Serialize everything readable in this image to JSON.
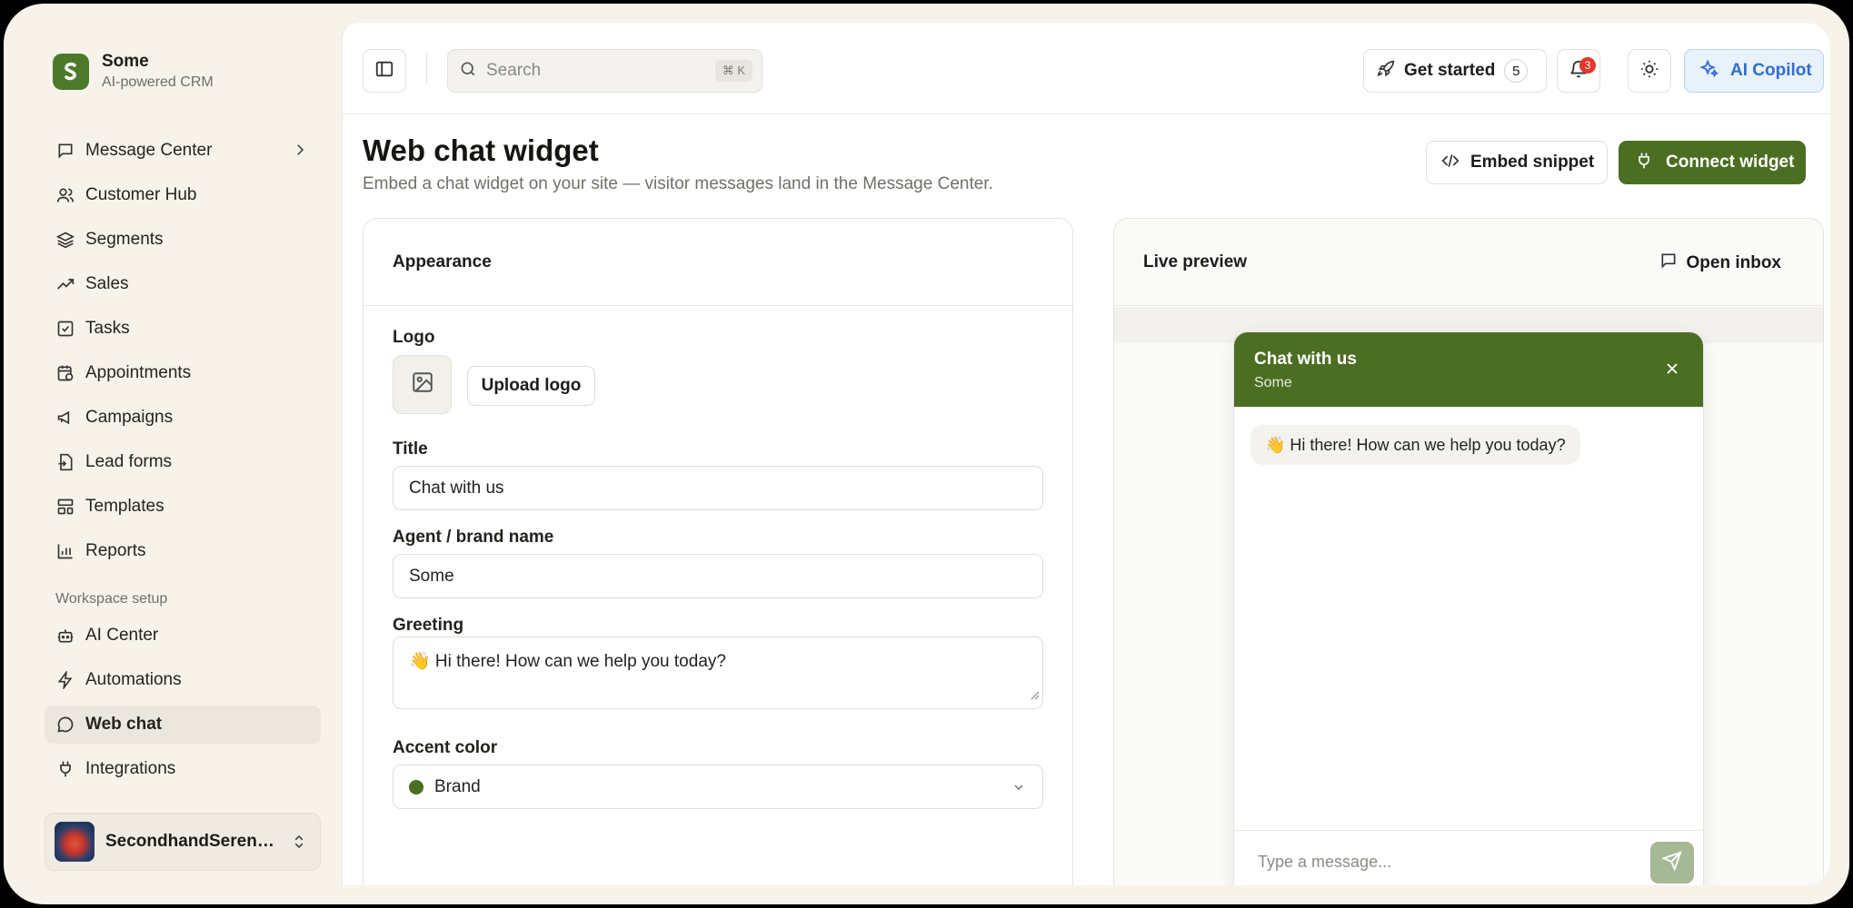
{
  "brand": {
    "name": "Some",
    "tagline": "AI-powered CRM"
  },
  "nav": {
    "items": [
      {
        "label": "Message Center"
      },
      {
        "label": "Customer Hub"
      },
      {
        "label": "Segments"
      },
      {
        "label": "Sales"
      },
      {
        "label": "Tasks"
      },
      {
        "label": "Appointments"
      },
      {
        "label": "Campaigns"
      },
      {
        "label": "Lead forms"
      },
      {
        "label": "Templates"
      },
      {
        "label": "Reports"
      }
    ],
    "section_label": "Workspace setup",
    "setup_items": [
      {
        "label": "AI Center"
      },
      {
        "label": "Automations"
      },
      {
        "label": "Web chat"
      },
      {
        "label": "Integrations"
      }
    ]
  },
  "account": {
    "name": "SecondhandSerenade"
  },
  "topbar": {
    "search_placeholder": "Search",
    "search_shortcut": "⌘ K",
    "get_started_label": "Get started",
    "get_started_count": "5",
    "notifications_count": "3",
    "ai_copilot_label": "AI Copilot"
  },
  "page": {
    "title": "Web chat widget",
    "subtitle": "Embed a chat widget on your site — visitor messages land in the Message Center.",
    "embed_label": "Embed snippet",
    "connect_label": "Connect widget"
  },
  "appearance": {
    "header": "Appearance",
    "logo_label": "Logo",
    "upload_label": "Upload logo",
    "title_label": "Title",
    "title_value": "Chat with us",
    "brand_label": "Agent / brand name",
    "brand_value": "Some",
    "greeting_label": "Greeting",
    "greeting_value": "👋 Hi there! How can we help you today?",
    "accent_label": "Accent color",
    "accent_value": "Brand"
  },
  "preview": {
    "header": "Live preview",
    "open_inbox_label": "Open inbox",
    "widget_title": "Chat with us",
    "widget_sub": "Some",
    "bubble_text": "👋 Hi there! How can we help you today?",
    "composer_placeholder": "Type a message..."
  },
  "colors": {
    "brand": "#4b6e22",
    "ai_accent": "#2f6fd1",
    "badge": "#e0392b"
  }
}
